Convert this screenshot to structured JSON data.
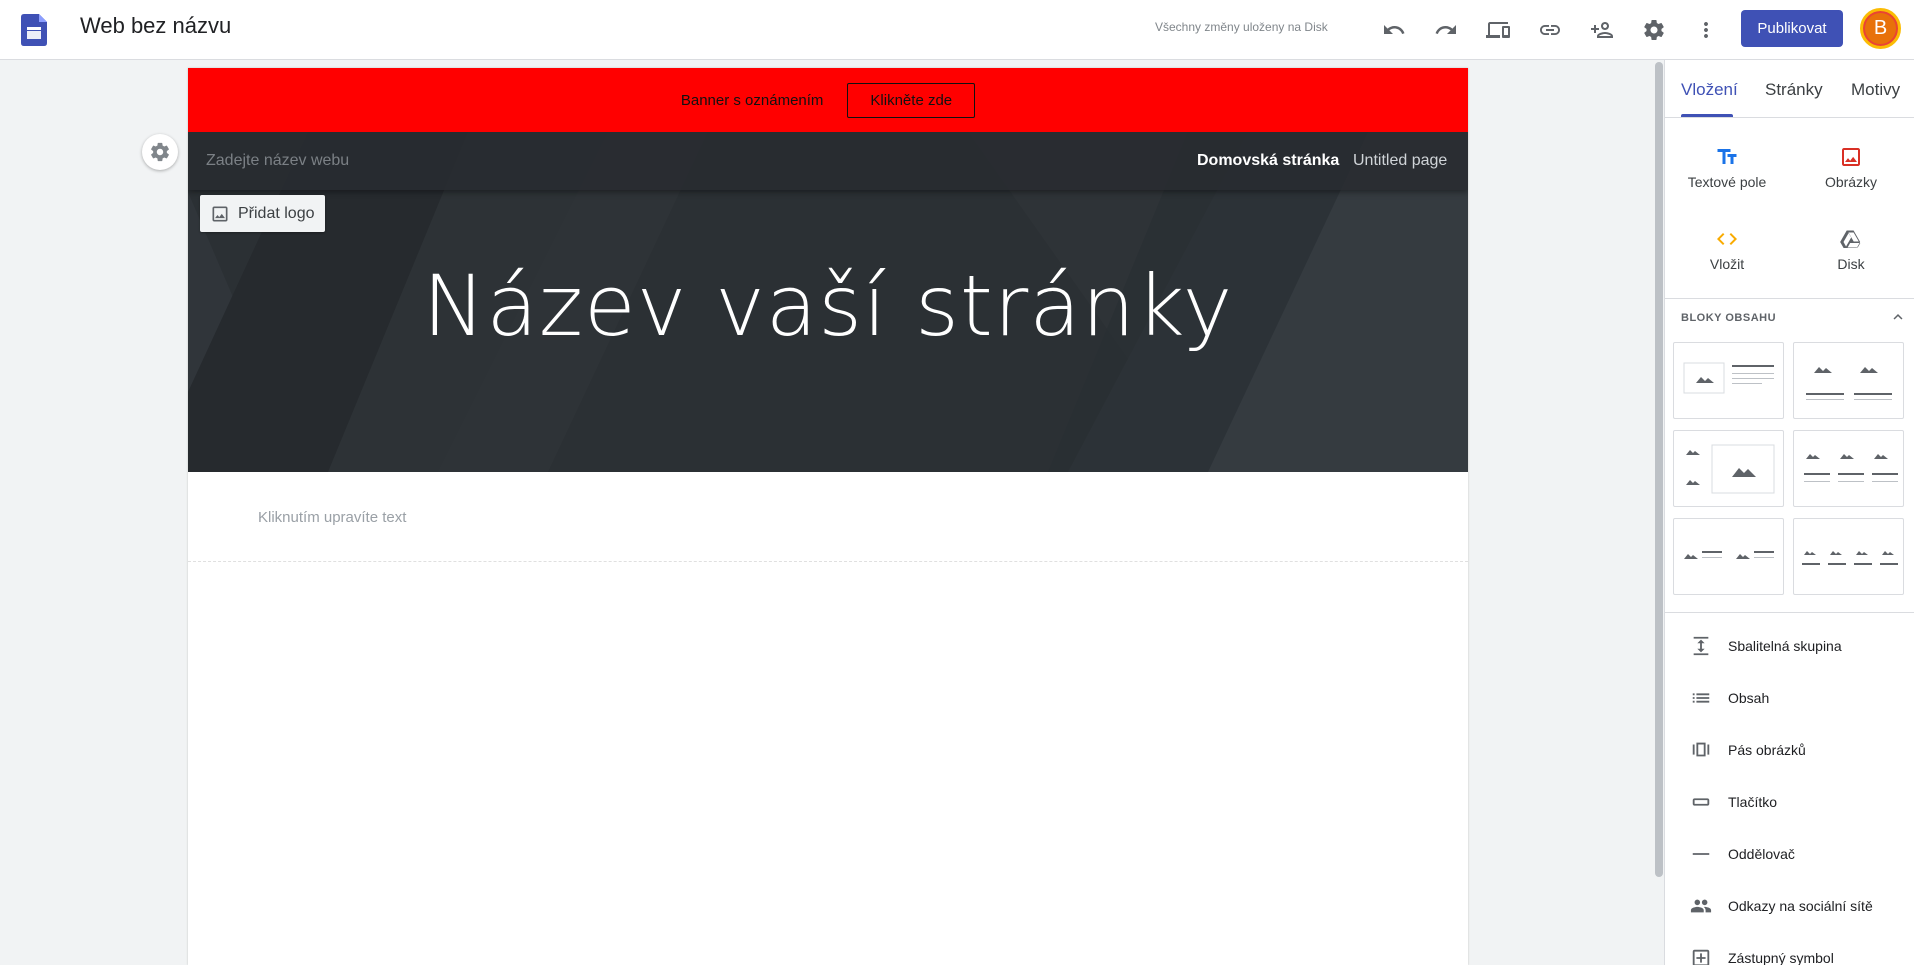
{
  "app": {
    "title": "Web bez názvu",
    "save_status": "Všechny změny uloženy na Disk",
    "publish_label": "Publikovat",
    "avatar_initial": "B"
  },
  "toolbar_icons": [
    "undo-icon",
    "redo-icon",
    "preview-device-icon",
    "link-icon",
    "share-person-icon",
    "settings-gear-icon",
    "more-vert-icon"
  ],
  "page": {
    "banner": {
      "text": "Banner s oznámením",
      "button": "Klikněte zde"
    },
    "site_name_placeholder": "Zadejte název webu",
    "nav": {
      "home": "Domovská stránka",
      "page": "Untitled page"
    },
    "add_logo": "Přidat logo",
    "hero_title": "Název vaší stránky",
    "text_placeholder": "Kliknutím upravíte text"
  },
  "panel": {
    "tabs": [
      {
        "label": "Vložení",
        "active": true
      },
      {
        "label": "Stránky",
        "active": false
      },
      {
        "label": "Motivy",
        "active": false
      }
    ],
    "insert": [
      {
        "label": "Textové pole",
        "icon": "text-box-icon",
        "color": "#1a73e8"
      },
      {
        "label": "Obrázky",
        "icon": "image-icon",
        "color": "#d93025"
      },
      {
        "label": "Vložit",
        "icon": "embed-code-icon",
        "color": "#f9ab00"
      },
      {
        "label": "Disk",
        "icon": "drive-icon",
        "color": "#5f6368"
      }
    ],
    "blocks_heading": "BLOKY OBSAHU",
    "components": [
      {
        "label": "Sbalitelná skupina",
        "icon": "collapsible-group-icon"
      },
      {
        "label": "Obsah",
        "icon": "table-of-contents-icon"
      },
      {
        "label": "Pás obrázků",
        "icon": "image-carousel-icon"
      },
      {
        "label": "Tlačítko",
        "icon": "button-icon"
      },
      {
        "label": "Oddělovač",
        "icon": "divider-icon"
      },
      {
        "label": "Odkazy na sociální sítě",
        "icon": "social-links-icon"
      },
      {
        "label": "Zástupný symbol",
        "icon": "placeholder-icon"
      }
    ]
  },
  "colors": {
    "accent": "#3f51b5",
    "banner": "#ff0000",
    "hero_bg": "#2b3034"
  }
}
